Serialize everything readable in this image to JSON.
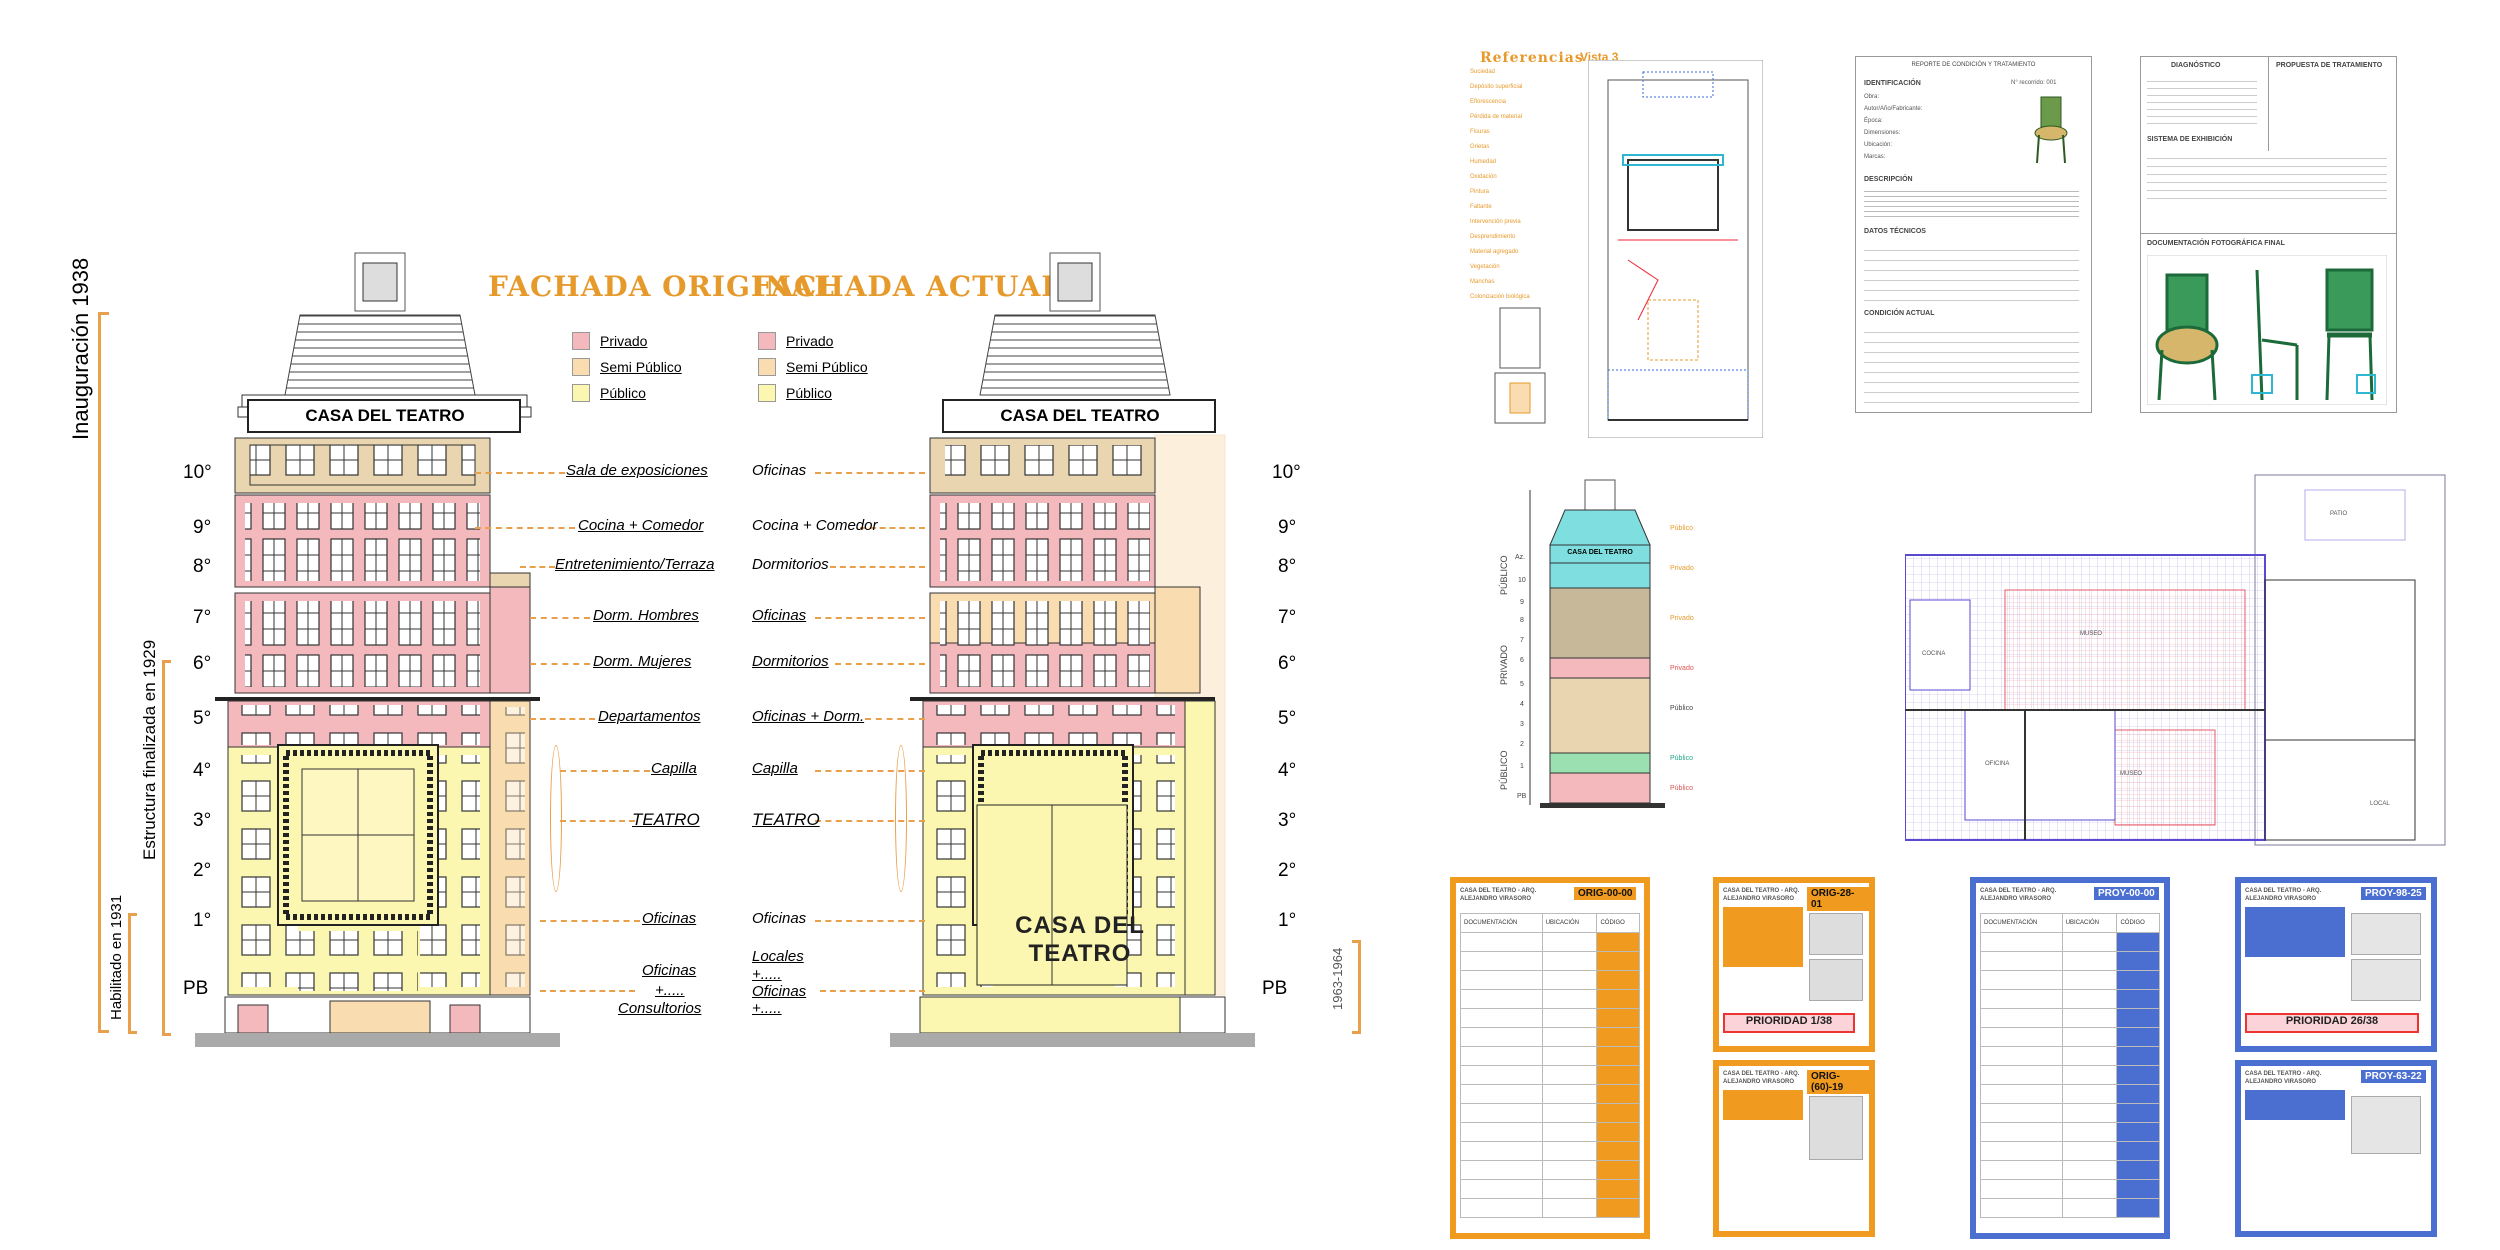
{
  "left": {
    "vertical_labels": {
      "inauguracion": "Inauguración 1938",
      "estructura": "Estructura finalizada en 1929",
      "habilitado": "Habilitado en 1931",
      "rango": "1963-1964"
    },
    "title_original": "FACHADA ORIGINAL",
    "title_actual": "FACHADA ACTUAL",
    "legend": [
      "Privado",
      "Semi Público",
      "Público"
    ],
    "legend_colors": [
      "#f4b9bd",
      "#f9dcb0",
      "#fbf6b0"
    ],
    "sign": "CASA DEL TEATRO",
    "marquee": "CASA DEL TEATRO",
    "floors": [
      "10°",
      "9°",
      "8°",
      "7°",
      "6°",
      "5°",
      "4°",
      "3°",
      "2°",
      "1°",
      "PB"
    ],
    "uses_original": [
      "Sala de exposiciones",
      "Cocina + Comedor",
      "Entretenimiento/Terraza",
      "Dorm. Hombres",
      "Dorm. Mujeres",
      "Departamentos",
      "Capilla",
      "TEATRO",
      "Oficinas",
      "Oficinas",
      "+.....",
      "Consultorios"
    ],
    "uses_actual": [
      "Oficinas",
      "Cocina + Comedor",
      "Dormitorios",
      "Oficinas",
      "Dormitorios",
      "Oficinas + Dorm.",
      "Capilla",
      "TEATRO",
      "Oficinas",
      "Locales",
      "+.....",
      "Oficinas",
      "+....."
    ]
  },
  "right": {
    "referencias_title": "Referencias",
    "vista_title": "Vista 3",
    "referencias_items": [
      "Suciedad",
      "Depósito superficial",
      "Eflorescencia",
      "Pérdida de material",
      "Fisuras",
      "Grietas",
      "Humedad",
      "Oxidación",
      "Pintura",
      "Faltante",
      "Intervención previa",
      "Desprendimiento",
      "Material agregado",
      "Vegetación",
      "Manchas",
      "Colonización biológica"
    ],
    "report": {
      "title": "REPORTE DE CONDICIÓN Y TRATAMIENTO",
      "identificacion": "IDENTIFICACIÓN",
      "numero": "N° recorrido: 001",
      "fields": [
        "Obra:",
        "Autor/Año/Fabricante:",
        "Época:",
        "Dimensiones:",
        "Ubicación:",
        "Marcas:"
      ],
      "descripcion": "DESCRIPCIÓN",
      "datos": "DATOS TÉCNICOS",
      "condicion": "CONDICIÓN ACTUAL"
    },
    "diagnostico": {
      "col1": "DIAGNÓSTICO",
      "col2": "PROPUESTA DE TRATAMIENTO",
      "sistema": "SISTEMA DE EXHIBICIÓN",
      "documentacion": "DOCUMENTACIÓN FOTOGRÁFICA FINAL"
    },
    "elevation_labels": [
      "Az.",
      "10",
      "9",
      "8",
      "7",
      "6",
      "5",
      "4",
      "3",
      "2",
      "1",
      "PB"
    ],
    "elevation_zones": [
      "PÚBLICO",
      "PRIVADO",
      "PÚBLICO"
    ],
    "elevation_sign": "CASA DEL TEATRO",
    "plan_labels": [
      "COCINA",
      "OFICINA",
      "MUSEO",
      "MUSEO",
      "LOCAL",
      "PATIO"
    ],
    "cards": [
      {
        "code": "ORIG-00-00",
        "priority": ""
      },
      {
        "code": "ORIG-28-01",
        "priority": "PRIORIDAD 1/38"
      },
      {
        "code": "ORIG-(60)-19",
        "priority": ""
      },
      {
        "code": "PROY-00-00",
        "priority": ""
      },
      {
        "code": "PROY-98-25",
        "priority": "PRIORIDAD 26/38"
      },
      {
        "code": "PROY-63-22",
        "priority": ""
      }
    ],
    "card_header": "CASA DEL TEATRO - ARQ. ALEJANDRO VIRASORO",
    "inventario_cols": [
      "DOCUMENTACIÓN",
      "UBICACIÓN",
      "CÓDIGO"
    ]
  }
}
